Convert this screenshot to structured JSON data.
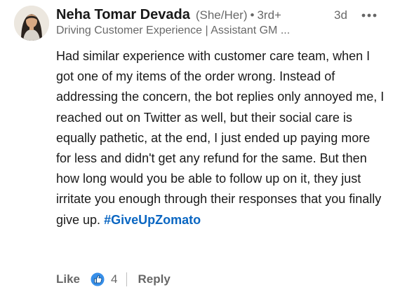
{
  "author": {
    "name": "Neha Tomar Devada",
    "pronouns": "(She/Her)",
    "separator": "•",
    "degree": "3rd+",
    "headline": "Driving Customer Experience | Assistant GM ..."
  },
  "timestamp": "3d",
  "comment": {
    "text": "Had similar experience with customer care team, when I got one of my items of the order wrong. Instead of addressing the concern, the bot replies only annoyed me, I reached out on Twitter as well, but their social care is equally pathetic, at the end, I just ended up paying more for less and didn't get any refund for the same. But then how long would you be able to follow up on it, they just irritate you enough through their responses that you finally give up.",
    "hashtag": "#GiveUpZomato"
  },
  "actions": {
    "like_label": "Like",
    "like_count": "4",
    "reply_label": "Reply",
    "reaction_icon": "thumbs-up-icon"
  },
  "colors": {
    "accent": "#0a66c2",
    "secondary_text": "rgba(0,0,0,0.6)"
  }
}
